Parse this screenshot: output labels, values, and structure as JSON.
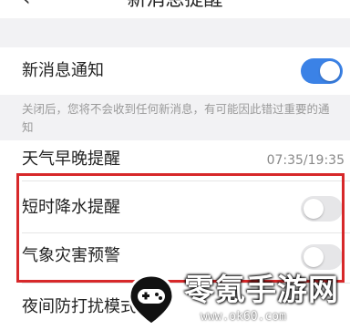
{
  "header": {
    "title": "新消息提醒",
    "back_icon": "chevron-left-icon"
  },
  "settings": {
    "new_message": {
      "label": "新消息通知",
      "enabled": true
    },
    "new_message_note": "关闭后，您将不会收到任何新消息，有可能因此错过重要的通知",
    "weather": {
      "label": "天气早晚提醒",
      "value": "07:35/19:35"
    },
    "short_rain": {
      "label": "短时降水提醒",
      "enabled": false
    },
    "disaster": {
      "label": "气象灾害预警",
      "enabled": false
    },
    "dnd": {
      "label": "夜间防打扰模式"
    }
  },
  "watermark": {
    "brand": "零氪手游网",
    "url": "www.ok60.com"
  },
  "colors": {
    "toggle_on": "#3b82e6",
    "toggle_off": "#e6e6e8",
    "highlight": "#d7282a",
    "background": "#f2f2f4"
  }
}
